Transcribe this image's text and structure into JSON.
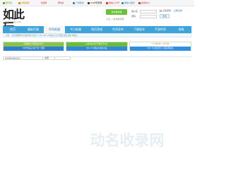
{
  "topbar": {
    "links": [
      {
        "label": "我们的",
        "color": "#5aa02c"
      },
      {
        "label": "领取福利",
        "color": "#d98a1a"
      },
      {
        "label": "【全部】",
        "color": "#d12b2b"
      },
      {
        "label": "【所在】",
        "color": "#d12b2b"
      },
      {
        "label": "广告联系",
        "color": "#2f7fb8"
      },
      {
        "label": "GOM登录器",
        "color": "#333333"
      },
      {
        "label": "微信公众号",
        "color": "#d12b2b"
      },
      {
        "label": "微信小程序",
        "color": "#2f7fb8"
      },
      {
        "label": "充值中心",
        "color": "#d12b2b"
      }
    ]
  },
  "logo": {
    "text": "如此玩",
    "tagline": "www.rucws.com"
  },
  "login": {
    "button": "发布服务器",
    "username_label": "用户名",
    "password_label": "密码",
    "remember_label": "记住密码",
    "register_link": "立即注册",
    "hint": "今天 → 发布服务器",
    "login_button": "登录"
  },
  "nav": {
    "items": [
      "首页",
      "最新开服",
      "传奇新服",
      "今日新服",
      "网页游戏",
      "传奇发布",
      "下载版本",
      "手游传奇",
      "攻略"
    ],
    "active_index": 2
  },
  "subnav": {
    "text": "导航：  传奇新服网  传奇发布网  红传奇  1.76  1.95  1.80复古  合击  微变  超变  迷失  单职业"
  },
  "promo": {
    "left": {
      "rows": [
        {
          "text": "无敌神兵·炎黄传说(PK1)",
          "bg": "#8bc34a",
          "color": "#ffffff"
        },
        {
          "text": "RP8天仙后0点开·唯一新服",
          "bg": "#2f7fd0",
          "color": "#ffffff"
        }
      ]
    },
    "middle": {
      "rows": [
        {
          "text": "火拼龙城·盛大开服4月29日",
          "bg": "#6cbb3a",
          "color": "#ffffff"
        },
        {
          "text": "PK1.76 单职业·独家首发",
          "bg": "#2f88d8",
          "color": "#ffffff"
        }
      ]
    },
    "right": {
      "rows": [
        {
          "text": "广告位招租 · QQ咨询",
          "bg": "#ffffff",
          "color": "#e07b1a"
        },
        {
          "text": "PK1.76 热血传奇·无限高爆版本",
          "bg": "#2f8fe0",
          "color": "#ffffff"
        }
      ]
    }
  },
  "filter": {
    "placeholder": "搜索服务器名称...",
    "select": "全部"
  },
  "watermark": {
    "text": "动名收录网",
    "color": "#e6eef5"
  }
}
